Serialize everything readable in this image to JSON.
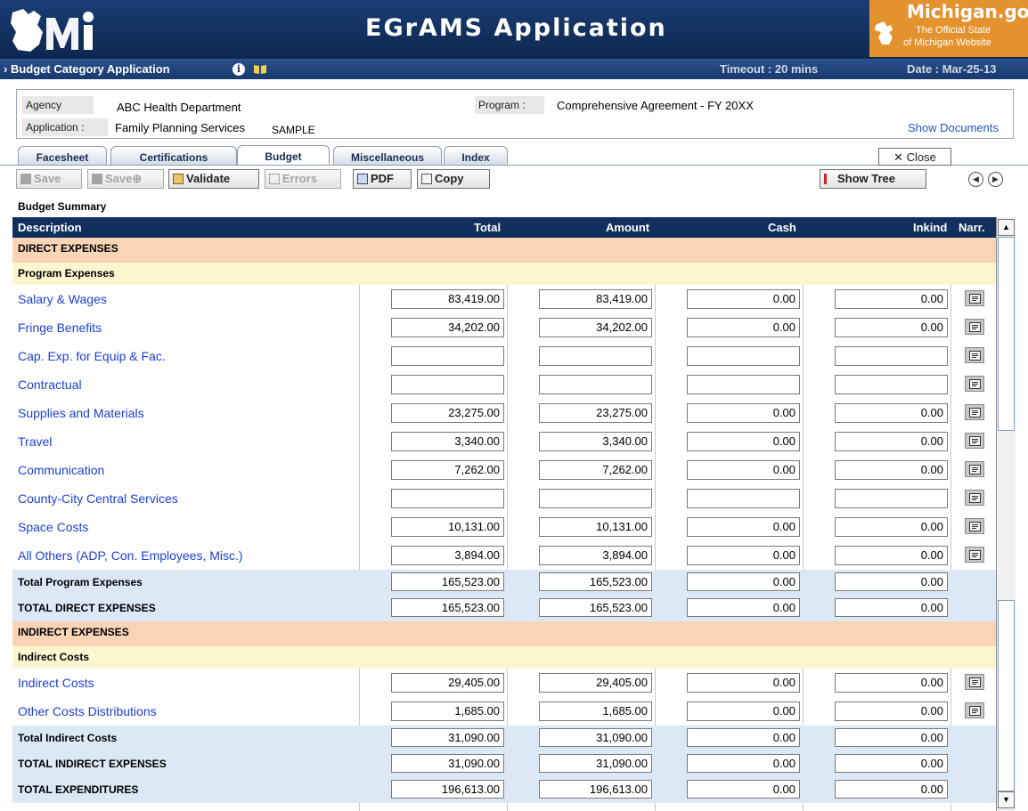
{
  "app_title": "EGrAMS Application",
  "michigan": {
    "brand": "Michigan.gov",
    "tagline1": "The Official State",
    "tagline2": "of Michigan Website"
  },
  "subheader": {
    "breadcrumb": "Budget Category Application",
    "timeout": "Timeout : 20 mins",
    "date": "Date : Mar-25-13"
  },
  "info": {
    "agency_label": "Agency",
    "agency": "ABC Health Department",
    "program_label": "Program :",
    "program": "Comprehensive Agreement - FY 20XX",
    "application_label": "Application :",
    "application": "Family Planning Services",
    "sample": "SAMPLE",
    "show_documents": "Show Documents"
  },
  "tabs": [
    "Facesheet",
    "Certifications",
    "Budget",
    "Miscellaneous",
    "Index"
  ],
  "close_label": "Close",
  "toolbar": {
    "save": "Save",
    "save_plus": "Save",
    "validate": "Validate",
    "errors": "Errors",
    "pdf": "PDF",
    "copy": "Copy",
    "show_tree": "Show Tree"
  },
  "summary_title": "Budget Summary",
  "columns": {
    "description": "Description",
    "total": "Total",
    "amount": "Amount",
    "cash": "Cash",
    "inkind": "Inkind",
    "narr": "Narr."
  },
  "rows": [
    {
      "type": "section",
      "label": "DIRECT EXPENSES"
    },
    {
      "type": "group",
      "label": "Program Expenses"
    },
    {
      "type": "item",
      "label": "Salary & Wages",
      "total": "83,419.00",
      "amount": "83,419.00",
      "cash": "0.00",
      "inkind": "0.00"
    },
    {
      "type": "item",
      "label": "Fringe Benefits",
      "total": "34,202.00",
      "amount": "34,202.00",
      "cash": "0.00",
      "inkind": "0.00"
    },
    {
      "type": "item",
      "label": "Cap. Exp. for Equip & Fac.",
      "total": "",
      "amount": "",
      "cash": "",
      "inkind": ""
    },
    {
      "type": "item",
      "label": "Contractual",
      "total": "",
      "amount": "",
      "cash": "",
      "inkind": ""
    },
    {
      "type": "item",
      "label": "Supplies and Materials",
      "total": "23,275.00",
      "amount": "23,275.00",
      "cash": "0.00",
      "inkind": "0.00"
    },
    {
      "type": "item",
      "label": "Travel",
      "total": "3,340.00",
      "amount": "3,340.00",
      "cash": "0.00",
      "inkind": "0.00"
    },
    {
      "type": "item",
      "label": "Communication",
      "total": "7,262.00",
      "amount": "7,262.00",
      "cash": "0.00",
      "inkind": "0.00"
    },
    {
      "type": "item",
      "label": "County-City Central Services",
      "total": "",
      "amount": "",
      "cash": "",
      "inkind": ""
    },
    {
      "type": "item",
      "label": "Space Costs",
      "total": "10,131.00",
      "amount": "10,131.00",
      "cash": "0.00",
      "inkind": "0.00"
    },
    {
      "type": "item",
      "label": "All Others (ADP, Con. Employees, Misc.)",
      "total": "3,894.00",
      "amount": "3,894.00",
      "cash": "0.00",
      "inkind": "0.00"
    },
    {
      "type": "total",
      "label": "Total Program Expenses",
      "total": "165,523.00",
      "amount": "165,523.00",
      "cash": "0.00",
      "inkind": "0.00"
    },
    {
      "type": "total",
      "label": "TOTAL DIRECT EXPENSES",
      "total": "165,523.00",
      "amount": "165,523.00",
      "cash": "0.00",
      "inkind": "0.00"
    },
    {
      "type": "section",
      "label": "INDIRECT EXPENSES"
    },
    {
      "type": "group",
      "label": "Indirect Costs"
    },
    {
      "type": "item",
      "label": "Indirect Costs",
      "total": "29,405.00",
      "amount": "29,405.00",
      "cash": "0.00",
      "inkind": "0.00"
    },
    {
      "type": "item",
      "label": "Other Costs Distributions",
      "total": "1,685.00",
      "amount": "1,685.00",
      "cash": "0.00",
      "inkind": "0.00"
    },
    {
      "type": "total",
      "label": "Total Indirect Costs",
      "total": "31,090.00",
      "amount": "31,090.00",
      "cash": "0.00",
      "inkind": "0.00"
    },
    {
      "type": "total",
      "label": "TOTAL INDIRECT EXPENSES",
      "total": "31,090.00",
      "amount": "31,090.00",
      "cash": "0.00",
      "inkind": "0.00"
    },
    {
      "type": "total",
      "label": "TOTAL EXPENDITURES",
      "total": "196,613.00",
      "amount": "196,613.00",
      "cash": "0.00",
      "inkind": "0.00"
    }
  ],
  "colors": {
    "header_navy": "#12305e",
    "section_bg": "#f9d4b5",
    "group_bg": "#fbf6d0",
    "total_bg": "#dde8f7",
    "link": "#1b3fd6",
    "brand_orange": "#e4922e"
  }
}
